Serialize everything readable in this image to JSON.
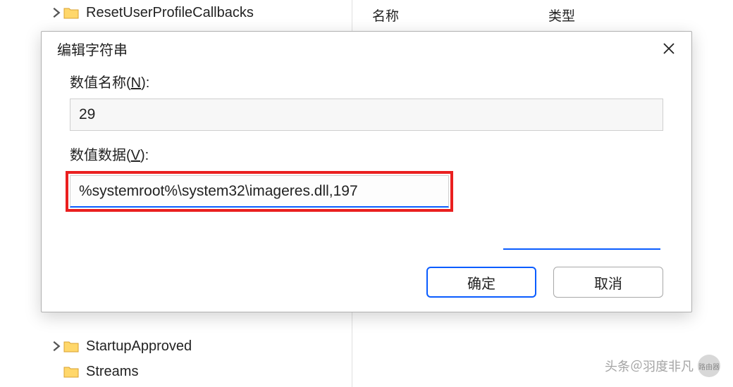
{
  "background": {
    "tree_items_top": [
      {
        "label": "ResetUserProfileCallbacks"
      }
    ],
    "tree_items_bottom": [
      {
        "label": "StartupApproved"
      },
      {
        "label": "Streams"
      }
    ],
    "list_columns": {
      "name": "名称",
      "type": "类型"
    }
  },
  "dialog": {
    "title": "编辑字符串",
    "name_label_prefix": "数值名称(",
    "name_label_hotkey": "N",
    "name_label_suffix": "):",
    "name_value": "29",
    "data_label_prefix": "数值数据(",
    "data_label_hotkey": "V",
    "data_label_suffix": "):",
    "data_value": "%systemroot%\\system32\\imageres.dll,197",
    "ok_label": "确定",
    "cancel_label": "取消"
  },
  "watermark": {
    "text": "头条＠羽度非凡",
    "badge": "路由器"
  }
}
